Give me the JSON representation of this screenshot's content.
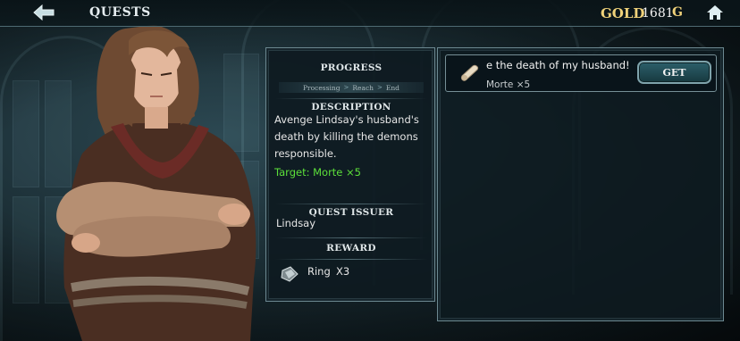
{
  "header": {
    "title": "QUESTS",
    "gold_label": "GOLD",
    "gold_value": "1681",
    "gold_unit": "G",
    "back_icon": "back-arrow-icon",
    "home_icon": "home-icon"
  },
  "detail": {
    "progress_title": "PROGRESS",
    "progress_steps": [
      "Processing",
      "Reach",
      "End"
    ],
    "description_title": "DESCRIPTION",
    "description_text": "Avenge Lindsay's husband's death by killing the demons responsible.",
    "target_text": "Target: Morte ×5",
    "issuer_title": "QUEST ISSUER",
    "issuer_name": "Lindsay",
    "reward_title": "REWARD",
    "reward_item": "Ring",
    "reward_qty": "X3",
    "reward_icon": "ring-icon"
  },
  "quest_list": {
    "items": [
      {
        "name": "e the death of my husband!",
        "target": "Morte ×5",
        "button_label": "GET",
        "icon": "scroll-icon"
      }
    ]
  },
  "colors": {
    "accent_gold": "#f0d27a",
    "target_green": "#5ce03a",
    "panel_border": "#6c8890"
  }
}
